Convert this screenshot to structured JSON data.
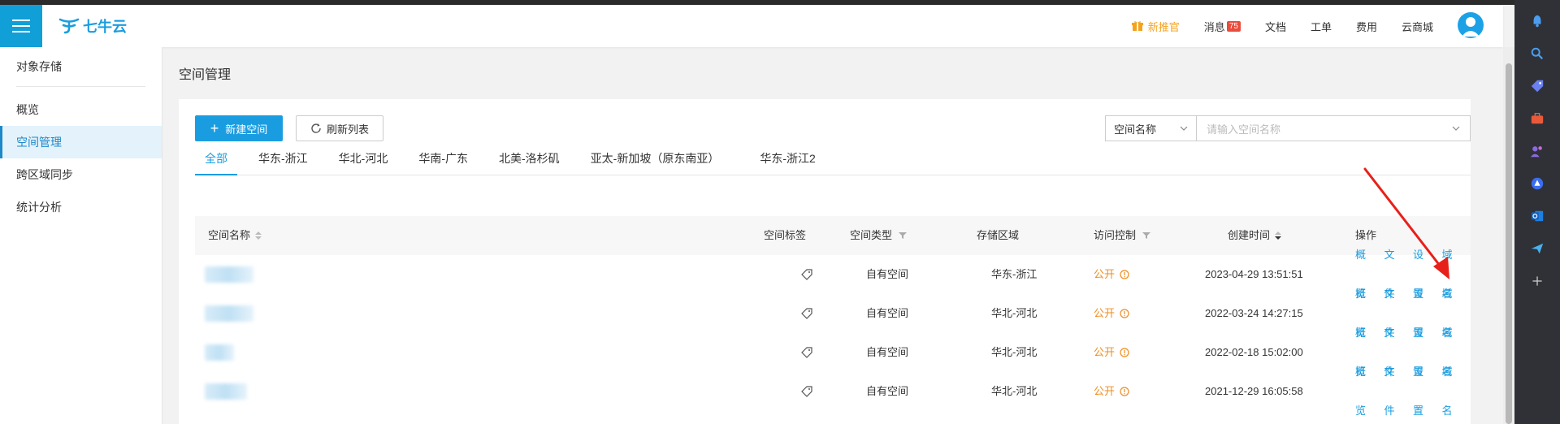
{
  "brand": {
    "name": "七牛云",
    "color": "#1a9de0"
  },
  "header": {
    "promo": "新推官",
    "messages": "消息",
    "messages_badge": "75",
    "docs": "文档",
    "tickets": "工单",
    "billing": "费用",
    "marketplace": "云商城"
  },
  "sidebar": {
    "title": "对象存储",
    "items": [
      {
        "label": "概览"
      },
      {
        "label": "空间管理",
        "active": true
      },
      {
        "label": "跨区域同步"
      },
      {
        "label": "统计分析"
      }
    ]
  },
  "main": {
    "title": "空间管理",
    "new_button": "新建空间",
    "refresh_button": "刷新列表",
    "search_select": "空间名称",
    "search_placeholder": "请输入空间名称",
    "tabs": [
      "全部",
      "华东-浙江",
      "华北-河北",
      "华南-广东",
      "北美-洛杉矶",
      "亚太-新加坡（原东南亚）",
      "华东-浙江2"
    ],
    "columns": {
      "name": "空间名称",
      "tag": "空间标签",
      "type": "空间类型",
      "region": "存储区域",
      "access": "访问控制",
      "created": "创建时间",
      "ops": "操作"
    },
    "rows": [
      {
        "type": "自有空间",
        "region": "华东-浙江",
        "access": "公开",
        "created": "2023-04-29 13:51:51"
      },
      {
        "type": "自有空间",
        "region": "华北-河北",
        "access": "公开",
        "created": "2022-03-24 14:27:15"
      },
      {
        "type": "自有空间",
        "region": "华北-河北",
        "access": "公开",
        "created": "2022-02-18 15:02:00"
      },
      {
        "type": "自有空间",
        "region": "华北-河北",
        "access": "公开",
        "created": "2021-12-29 16:05:58"
      }
    ],
    "ops": {
      "overview": "概览",
      "files": "文件",
      "settings": "设置",
      "domain": "域名"
    }
  }
}
